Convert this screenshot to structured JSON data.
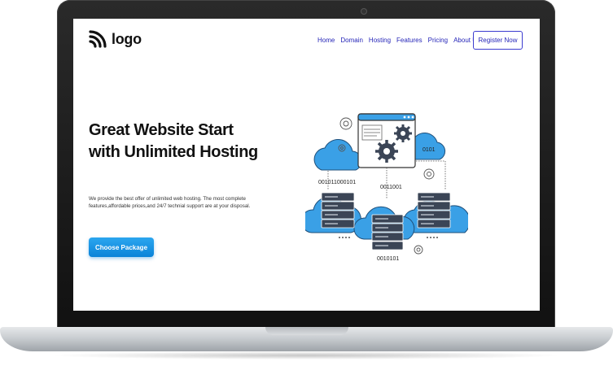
{
  "brand": {
    "logo_text": "logo"
  },
  "nav": {
    "items": [
      {
        "label": "Home"
      },
      {
        "label": "Domain"
      },
      {
        "label": "Hosting"
      },
      {
        "label": "Features"
      },
      {
        "label": "Pricing"
      },
      {
        "label": "About Us"
      }
    ],
    "register_label": "Register Now"
  },
  "hero": {
    "title": "Great Website Start with Unlimited Hosting",
    "description": "We provide the best offer of unlimited web hosting. The most complete features,affordable prices,and 24/7 technial support are at your disposal.",
    "cta_label": "Choose Package"
  },
  "illustration": {
    "binary_1": "001011000101",
    "binary_2": "0011001",
    "binary_3": "0101",
    "binary_4": "0010101"
  },
  "colors": {
    "nav_link": "#2525b8",
    "cta_blue": "#0b83d8",
    "cloud_blue": "#3aa0e6",
    "server_dark": "#3b4556"
  }
}
